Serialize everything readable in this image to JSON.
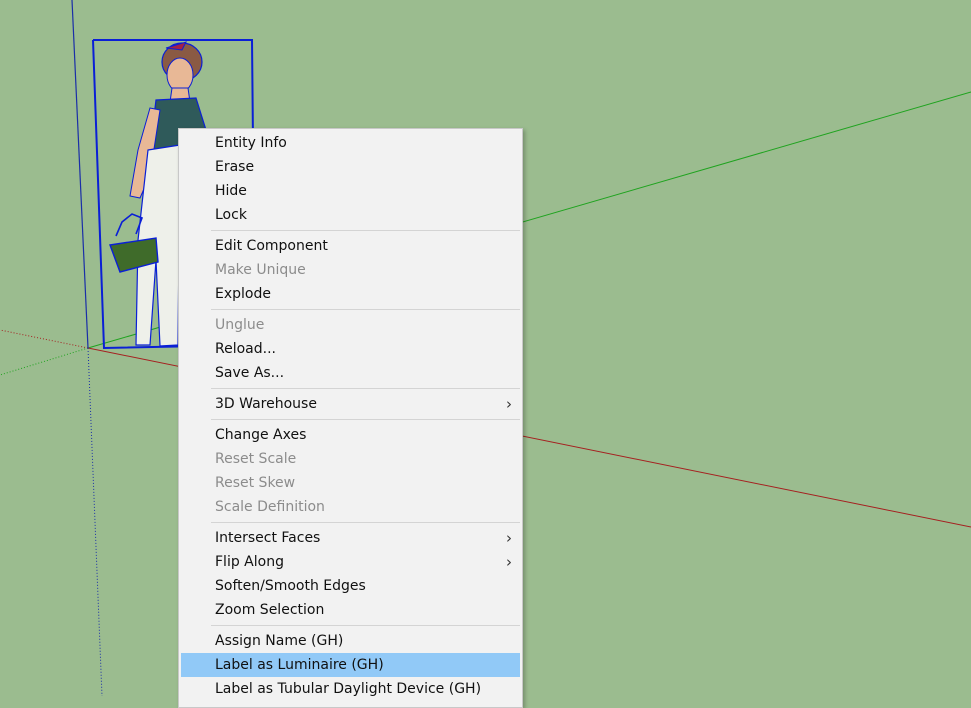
{
  "context_menu": {
    "groups": [
      {
        "items": [
          {
            "label": "Entity Info",
            "enabled": true
          },
          {
            "label": "Erase",
            "enabled": true
          },
          {
            "label": "Hide",
            "enabled": true
          },
          {
            "label": "Lock",
            "enabled": true
          }
        ]
      },
      {
        "items": [
          {
            "label": "Edit Component",
            "enabled": true
          },
          {
            "label": "Make Unique",
            "enabled": false
          },
          {
            "label": "Explode",
            "enabled": true
          }
        ]
      },
      {
        "items": [
          {
            "label": "Unglue",
            "enabled": false
          },
          {
            "label": "Reload...",
            "enabled": true
          },
          {
            "label": "Save As...",
            "enabled": true
          }
        ]
      },
      {
        "items": [
          {
            "label": "3D Warehouse",
            "enabled": true,
            "submenu": true
          }
        ]
      },
      {
        "items": [
          {
            "label": "Change Axes",
            "enabled": true
          },
          {
            "label": "Reset Scale",
            "enabled": false
          },
          {
            "label": "Reset Skew",
            "enabled": false
          },
          {
            "label": "Scale Definition",
            "enabled": false
          }
        ]
      },
      {
        "items": [
          {
            "label": "Intersect Faces",
            "enabled": true,
            "submenu": true
          },
          {
            "label": "Flip Along",
            "enabled": true,
            "submenu": true
          },
          {
            "label": "Soften/Smooth Edges",
            "enabled": true
          },
          {
            "label": "Zoom Selection",
            "enabled": true
          }
        ]
      },
      {
        "items": [
          {
            "label": "Assign Name (GH)",
            "enabled": true
          },
          {
            "label": "Label as Luminaire (GH)",
            "enabled": true,
            "highlighted": true
          },
          {
            "label": "Label as Tubular Daylight Device (GH)",
            "enabled": true
          }
        ]
      }
    ],
    "submenu_glyph": "›"
  },
  "colors": {
    "viewport_background": "#9bbc8f",
    "green_axis": "#1fa31f",
    "red_axis": "#a52020",
    "blue_axis": "#1a2ea8",
    "selection_box": "#0a1fd6",
    "menu_background": "#f2f2f2",
    "menu_highlight": "#91c9f7",
    "disabled_text": "#8c8c8c"
  },
  "icons": {
    "chevron": "chevron-right-icon"
  }
}
